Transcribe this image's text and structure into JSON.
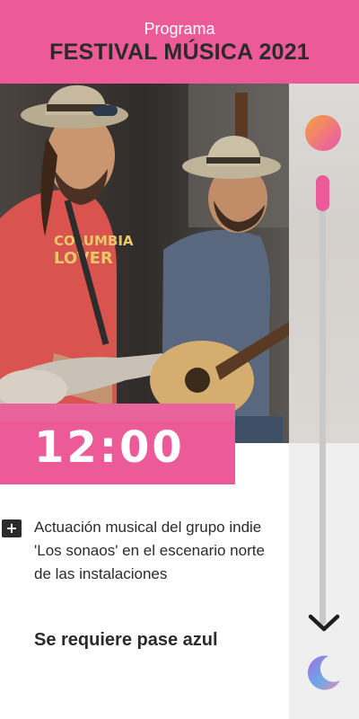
{
  "header": {
    "subtitle": "Programa",
    "title": "FESTIVAL MÚSICA 2021"
  },
  "photo": {
    "shirt_print_line1": "COLUMBIA",
    "shirt_print_line2": "LOVER"
  },
  "event": {
    "time": "12:00",
    "description": "Actuación musical del grupo indie 'Los sonaos' en el escenario norte de las instalaciones",
    "requirement": "Se requiere pase azul"
  },
  "controls": {
    "expand_symbol": "+",
    "icons": [
      "sun-icon",
      "scroll-down-arrow-icon",
      "moon-icon"
    ]
  },
  "colors": {
    "accent": "#ec5a97",
    "text": "#2b2b2b",
    "rail": "#efefef"
  }
}
